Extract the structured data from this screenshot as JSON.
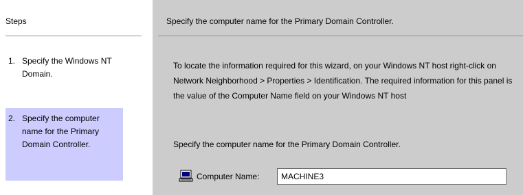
{
  "steps": {
    "title": "Steps",
    "items": [
      {
        "number": "1.",
        "label": "Specify the Windows NT Domain."
      },
      {
        "number": "2.",
        "label": "Specify the computer name for the Primary Domain Controller."
      }
    ],
    "active_index": 1
  },
  "main": {
    "header": "Specify the computer name for the Primary Domain Controller.",
    "instructions": "To locate the information required for this wizard, on your Windows NT host right-click on Network Neighborhood > Properties > Identification. The required information for this panel is the value of the Computer Name field on your Windows NT host",
    "prompt": "Specify the computer name for the Primary Domain Controller.",
    "field": {
      "icon": "computer-icon",
      "label": "Computer Name:",
      "value": "MACHINE3"
    }
  },
  "colors": {
    "active_step_bg": "#ccccff",
    "panel_bg": "#cccccc",
    "rule": "#8c8c9c"
  }
}
